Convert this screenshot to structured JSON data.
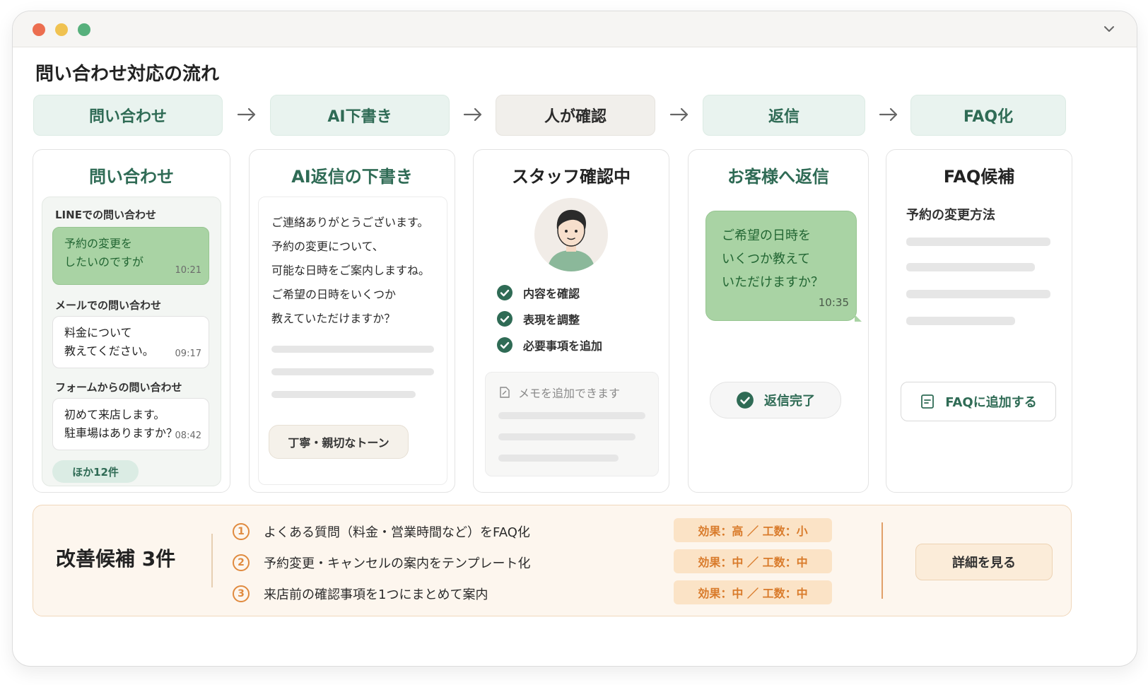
{
  "page_title": "問い合わせ対応の流れ",
  "colors": {
    "accent_green": "#2f6b55",
    "bubble_green": "#a9d3a4",
    "accent_orange": "#e08a3e"
  },
  "steps": [
    {
      "label": "問い合わせ"
    },
    {
      "label": "AI下書き"
    },
    {
      "label": "人が確認"
    },
    {
      "label": "返信"
    },
    {
      "label": "FAQ化"
    }
  ],
  "inquiry": {
    "title": "問い合わせ",
    "sources": [
      {
        "label": "LINEでの問い合わせ",
        "line1": "予約の変更を",
        "line2": "したいのですが",
        "time": "10:21"
      },
      {
        "label": "メールでの問い合わせ",
        "line1": "料金について",
        "line2": "教えてください。",
        "time": "09:17"
      },
      {
        "label": "フォームからの問い合わせ",
        "line1": "初めて来店します。",
        "line2": "駐車場はありますか？",
        "time": "08:42"
      }
    ],
    "more": "ほか12件"
  },
  "draft": {
    "title": "AI返信の下書き",
    "lines": [
      "ご連絡ありがとうございます。",
      "予約の変更について、",
      "可能な日時をご案内しますね。",
      "ご希望の日時をいくつか",
      "教えていただけますか？"
    ],
    "tone": "丁寧・親切なトーン"
  },
  "review": {
    "title": "スタッフ確認中",
    "checks": [
      "内容を確認",
      "表現を調整",
      "必要事項を追加"
    ],
    "memo_placeholder": "メモを追加できます"
  },
  "reply": {
    "title": "お客様へ返信",
    "lines": [
      "ご希望の日時を",
      "いくつか教えて",
      "いただけますか？"
    ],
    "time": "10:35",
    "status": "返信完了"
  },
  "faq": {
    "title": "FAQ候補",
    "item": "予約の変更方法",
    "button": "FAQに追加する"
  },
  "improvements": {
    "title": "改善候補 3件",
    "items": [
      {
        "num": "1",
        "text": "よくある質問（料金・営業時間など）をFAQ化",
        "tag": "効果：高 ／ 工数：小"
      },
      {
        "num": "2",
        "text": "予約変更・キャンセルの案内をテンプレート化",
        "tag": "効果：中 ／ 工数：中"
      },
      {
        "num": "3",
        "text": "来店前の確認事項を1つにまとめて案内",
        "tag": "効果：中 ／ 工数：中"
      }
    ],
    "button": "詳細を見る"
  }
}
